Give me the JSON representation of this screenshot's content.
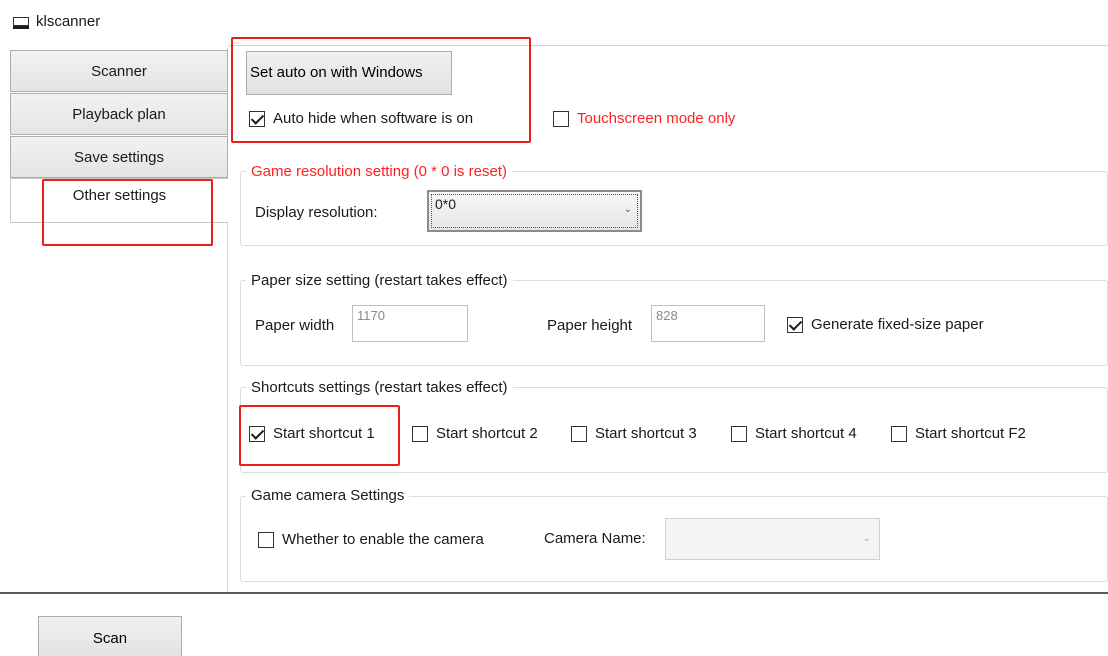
{
  "window": {
    "title": "klscanner"
  },
  "nav": {
    "items": [
      {
        "label": "Scanner"
      },
      {
        "label": "Playback plan"
      },
      {
        "label": "Save settings"
      },
      {
        "label": "Other settings",
        "selected": true
      }
    ]
  },
  "general": {
    "autostart_label": "Set auto on with Windows",
    "auto_hide": {
      "label": "Auto hide when software is on",
      "checked": true
    },
    "touchscreen": {
      "label": "Touchscreen mode only",
      "checked": false
    }
  },
  "game_resolution": {
    "title": "Game resolution setting (0 * 0 is reset)",
    "display_label": "Display resolution:",
    "display_value": "0*0"
  },
  "paper_size": {
    "title": "Paper size setting (restart takes effect)",
    "width_label": "Paper width",
    "width_value": "1170",
    "height_label": "Paper height",
    "height_value": "828",
    "fixed_size": {
      "label": "Generate fixed-size paper",
      "checked": true
    }
  },
  "shortcuts": {
    "title": "Shortcuts settings (restart takes effect)",
    "items": [
      {
        "label": "Start shortcut 1",
        "checked": true
      },
      {
        "label": "Start shortcut 2",
        "checked": false
      },
      {
        "label": "Start shortcut 3",
        "checked": false
      },
      {
        "label": "Start shortcut 4",
        "checked": false
      },
      {
        "label": "Start shortcut F2",
        "checked": false
      }
    ]
  },
  "camera": {
    "title": "Game camera Settings",
    "enable": {
      "label": "Whether to enable the camera",
      "checked": false
    },
    "name_label": "Camera Name:",
    "name_value": ""
  },
  "footer": {
    "scan_label": "Scan"
  },
  "colors": {
    "highlight": "#e8201c",
    "warning_text": "#ff2020"
  }
}
